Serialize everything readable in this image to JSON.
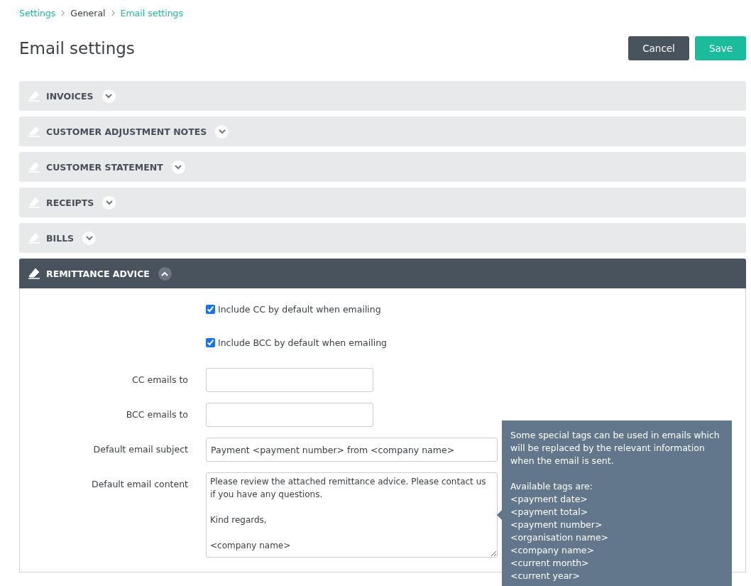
{
  "breadcrumb": [
    {
      "label": "Settings",
      "link": true
    },
    {
      "label": "General",
      "link": false
    },
    {
      "label": "Email settings",
      "link": true
    }
  ],
  "title": "Email settings",
  "buttons": [
    {
      "label": "Cancel",
      "kind": "secondary"
    },
    {
      "label": "Save",
      "kind": "primary"
    }
  ],
  "sections": [
    {
      "label": "INVOICES",
      "expanded": false
    },
    {
      "label": "CUSTOMER ADJUSTMENT NOTES",
      "expanded": false
    },
    {
      "label": "CUSTOMER STATEMENT",
      "expanded": false
    },
    {
      "label": "RECEIPTS",
      "expanded": false
    },
    {
      "label": "BILLS",
      "expanded": false
    },
    {
      "label": "REMITTANCE ADVICE",
      "expanded": true
    }
  ],
  "form": [
    {
      "kind": "checkbox",
      "label": "Include CC by default when emailing",
      "checked": true
    },
    {
      "kind": "checkbox",
      "label": "Include BCC by default when emailing",
      "checked": true
    },
    {
      "kind": "text",
      "label": "CC emails to"
    },
    {
      "kind": "text",
      "label": "BCC emails to"
    },
    {
      "kind": "widetext",
      "label": "Default email subject",
      "value": "Payment <payment number> from <company name>"
    },
    {
      "kind": "textarea",
      "label": "Default email content",
      "value": "Please review the attached remittance advice. Please contact us if you have any questions.\n\nKind regards,\n\n<company name>"
    }
  ],
  "tooltip": {
    "intro": "Some special tags can be used in emails which will be replaced by the relevant information when the email is sent.",
    "heading": "Available tags are:",
    "tags": [
      "<payment date>",
      "<payment total>",
      "<payment number>",
      "<organisation name>",
      "<company name>",
      "<current month>",
      "<current year>"
    ]
  }
}
